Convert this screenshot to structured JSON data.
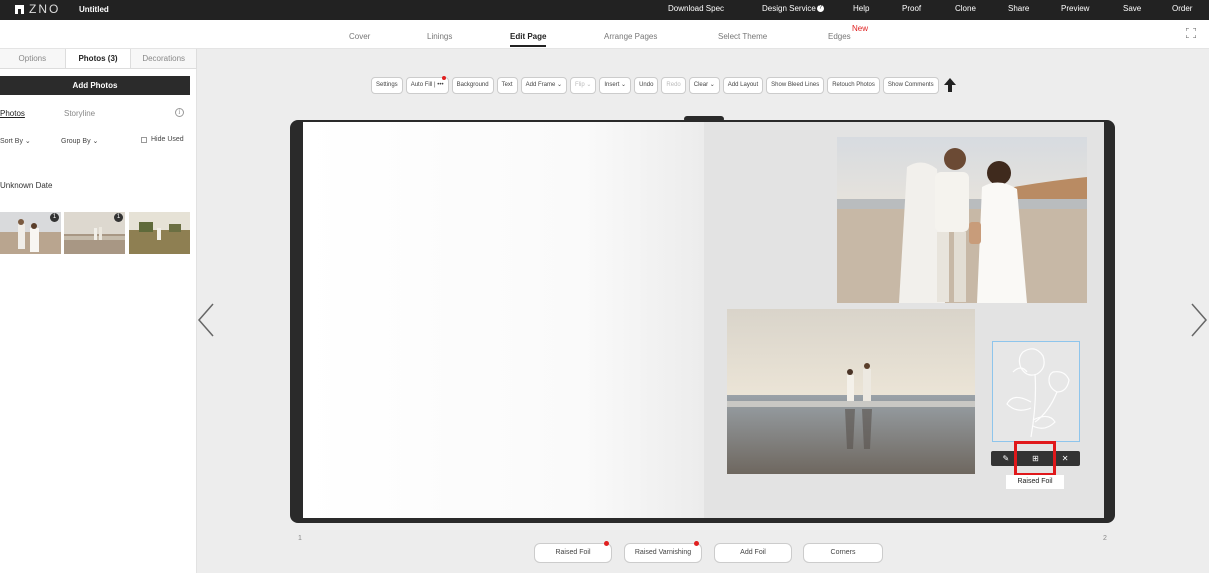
{
  "topbar": {
    "logo_text": "ZNO",
    "project_title": "Untitled",
    "menu": {
      "download_spec": "Download Spec",
      "design_service": "Design Service",
      "design_service_badge": "?",
      "help": "Help",
      "proof": "Proof",
      "clone": "Clone",
      "share": "Share",
      "preview": "Preview",
      "save": "Save",
      "order": "Order"
    }
  },
  "nav": {
    "tabs": [
      {
        "label": "Cover"
      },
      {
        "label": "Linings"
      },
      {
        "label": "Edit Page"
      },
      {
        "label": "Arrange Pages"
      },
      {
        "label": "Select Theme"
      },
      {
        "label": "Edges"
      }
    ],
    "new_badge": "New",
    "active_tab": "Edit Page"
  },
  "sidebar": {
    "tabs": [
      {
        "label": "Options"
      },
      {
        "label": "Photos (3)"
      },
      {
        "label": "Decorations"
      }
    ],
    "add_photos": "Add Photos",
    "sub_tabs": {
      "photos": "Photos",
      "storyline": "Storyline"
    },
    "info": "i",
    "filters": {
      "sort_by": "Sort By ⌄",
      "group_by": "Group By ⌄",
      "hide_used": "Hide Used"
    },
    "date_group": "Unknown Date",
    "thumbnails": [
      {
        "count": "1"
      },
      {
        "count": "1"
      },
      {
        "count": ""
      }
    ]
  },
  "toolbar": {
    "buttons": [
      {
        "label": "Settings"
      },
      {
        "label": "Auto Fill | •••"
      },
      {
        "label": "Background"
      },
      {
        "label": "Text"
      },
      {
        "label": "Add Frame ⌄"
      },
      {
        "label": "Flip ⌄"
      },
      {
        "label": "Insert ⌄"
      },
      {
        "label": "Undo"
      },
      {
        "label": "Redo"
      },
      {
        "label": "Clear ⌄"
      },
      {
        "label": "Add Layout"
      },
      {
        "label": "Show Bleed Lines"
      },
      {
        "label": "Retouch Photos"
      },
      {
        "label": "Show Comments"
      }
    ]
  },
  "canvas": {
    "foil_actions": {
      "edit": "✎",
      "grid": "⊞",
      "close": "✕"
    },
    "foil_label": "Raised Foil",
    "page_left_num": "1",
    "page_right_num": "2"
  },
  "bottom": {
    "raised_foil": "Raised Foil",
    "raised_varnishing": "Raised Varnishing",
    "add_foil": "Add Foil",
    "corners": "Corners"
  },
  "colors": {
    "topbar": "#222222",
    "accent_red": "#e02020",
    "highlight": "#e0181b",
    "selection": "#8ec5ec"
  }
}
